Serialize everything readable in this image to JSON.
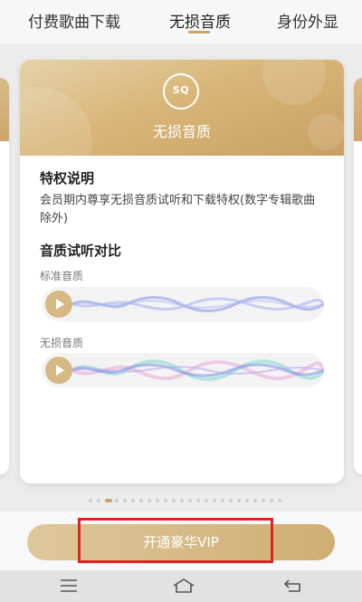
{
  "tabs": [
    {
      "label": "付费歌曲下载"
    },
    {
      "label": "无损音质"
    },
    {
      "label": "身份外显"
    }
  ],
  "card": {
    "badge": "SQ",
    "title": "无损音质",
    "privilege": {
      "heading": "特权说明",
      "description": "会员期内尊享无损音质试听和下载特权(数字专辑歌曲除外)"
    },
    "compare": {
      "heading": "音质试听对比",
      "samples": [
        {
          "label": "标准音质"
        },
        {
          "label": "无损音质"
        }
      ]
    }
  },
  "pagination": {
    "count": 24,
    "active_index": 2
  },
  "vip_button": {
    "label": "开通豪华VIP"
  },
  "colors": {
    "gold": "#c9a46a",
    "highlight": "#e02222",
    "wave_blue": "#7f8ee8",
    "wave_teal": "#7fd6d0",
    "wave_pink": "#e7a2d8"
  },
  "icons": {
    "play": "play-icon",
    "menu": "menu-icon",
    "home": "home-icon",
    "back": "back-icon"
  }
}
